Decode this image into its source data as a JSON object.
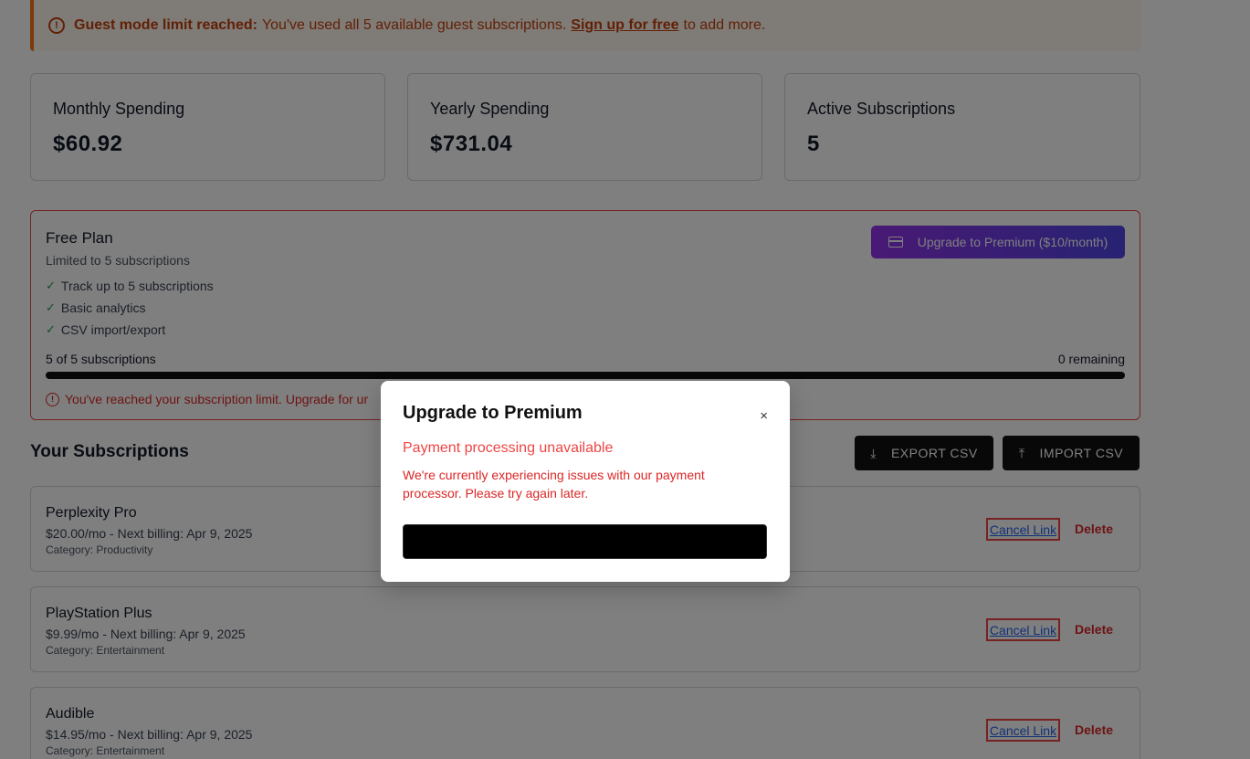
{
  "banner": {
    "strong": "Guest mode limit reached:",
    "text": "You've used all 5 available guest subscriptions.",
    "link": "Sign up for free",
    "suffix": "to add more."
  },
  "stats": [
    {
      "label": "Monthly Spending",
      "value": "$60.92"
    },
    {
      "label": "Yearly Spending",
      "value": "$731.04"
    },
    {
      "label": "Active Subscriptions",
      "value": "5"
    }
  ],
  "plan": {
    "title": "Free Plan",
    "subtitle": "Limited to 5 subscriptions",
    "features": [
      "Track up to 5 subscriptions",
      "Basic analytics",
      "CSV import/export"
    ],
    "usage_left": "5 of 5 subscriptions",
    "usage_right": "0 remaining",
    "usage_fraction": 1.0,
    "limit_msg": "You've reached your subscription limit. Upgrade for ur",
    "upgrade_label": "Upgrade to Premium ($10/month)"
  },
  "subscriptions_title": "Your Subscriptions",
  "export_label": "EXPORT CSV",
  "import_label": "IMPORT CSV",
  "subscriptions": [
    {
      "name": "Perplexity Pro",
      "price": "$20.00/mo - Next billing: Apr 9, 2025",
      "category": "Category: Productivity",
      "cancel": "Cancel Link",
      "delete": "Delete"
    },
    {
      "name": "PlayStation Plus",
      "price": "$9.99/mo - Next billing: Apr 9, 2025",
      "category": "Category: Entertainment",
      "cancel": "Cancel Link",
      "delete": "Delete"
    },
    {
      "name": "Audible",
      "price": "$14.95/mo - Next billing: Apr 9, 2025",
      "category": "Category: Entertainment",
      "cancel": "Cancel Link",
      "delete": "Delete"
    }
  ],
  "modal": {
    "title": "Upgrade to Premium",
    "close": "×",
    "error_title": "Payment processing unavailable",
    "error_body": "We're currently experiencing issues with our payment processor. Please try again later."
  },
  "colors": {
    "accent_from": "#9333ea",
    "accent_to": "#4f46e5",
    "error": "#ef4444",
    "warning": "#f97316"
  }
}
